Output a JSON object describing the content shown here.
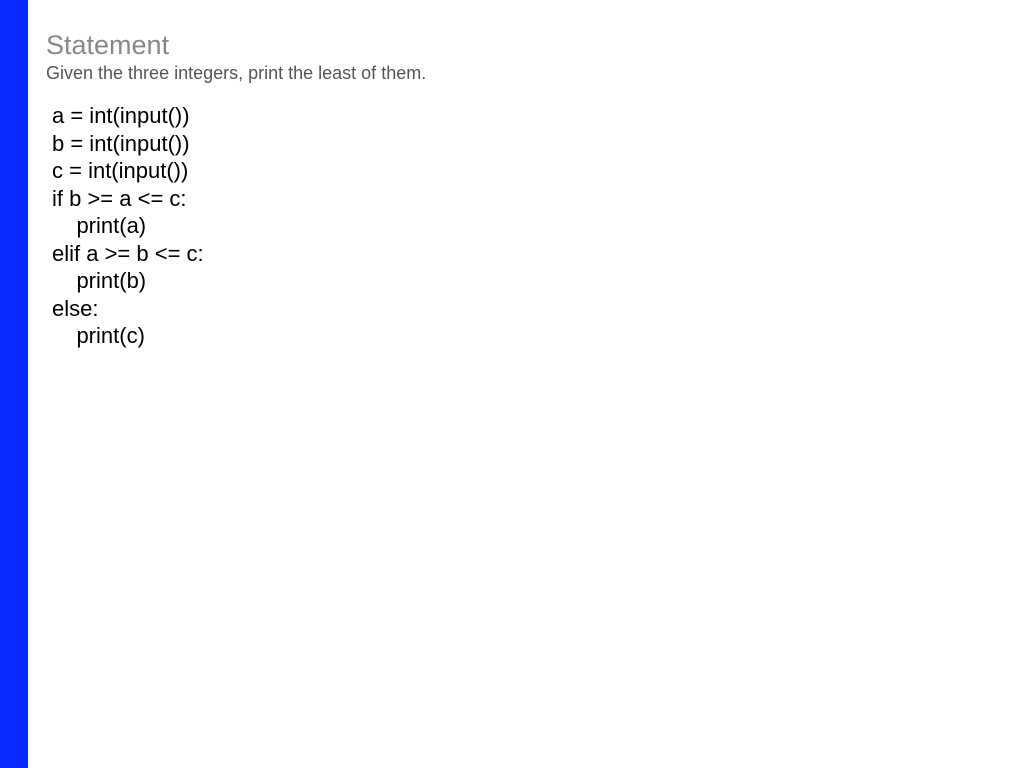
{
  "heading": "Statement",
  "description": "Given the three integers, print the least of them.",
  "code": "a = int(input())\nb = int(input())\nc = int(input())\nif b >= a <= c:\n    print(a)\nelif a >= b <= c:\n    print(b)\nelse:\n    print(c)"
}
